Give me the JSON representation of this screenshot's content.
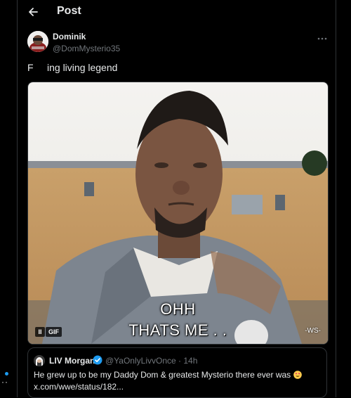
{
  "header": {
    "title": "Post"
  },
  "post": {
    "author": {
      "display_name": "Dominik",
      "handle": "@DomMysterio35"
    },
    "text": "F     ing living legend",
    "media": {
      "caption_line1": "OHH",
      "caption_line2": "THATS ME . .",
      "watermark": "-WS-",
      "badge": "GIF",
      "pause_glyph": "II"
    }
  },
  "quote": {
    "author": {
      "display_name": "LIV Morgan",
      "handle": "@YaOnlyLivvOnce",
      "time": "· 14h"
    },
    "text": "He grew up to be my Daddy Dom & greatest Mysterio there ever was",
    "link": "x.com/wwe/status/182..."
  },
  "left_rail": {
    "more_glyph": "··"
  },
  "colors": {
    "accent": "#1d9bf0",
    "border": "#2f3336",
    "muted": "#71767b",
    "text": "#e7e9ea"
  },
  "icons": [
    "back-arrow-icon",
    "more-icon",
    "verified-badge-icon",
    "heart-eyes-emoji-icon",
    "pause-icon"
  ]
}
